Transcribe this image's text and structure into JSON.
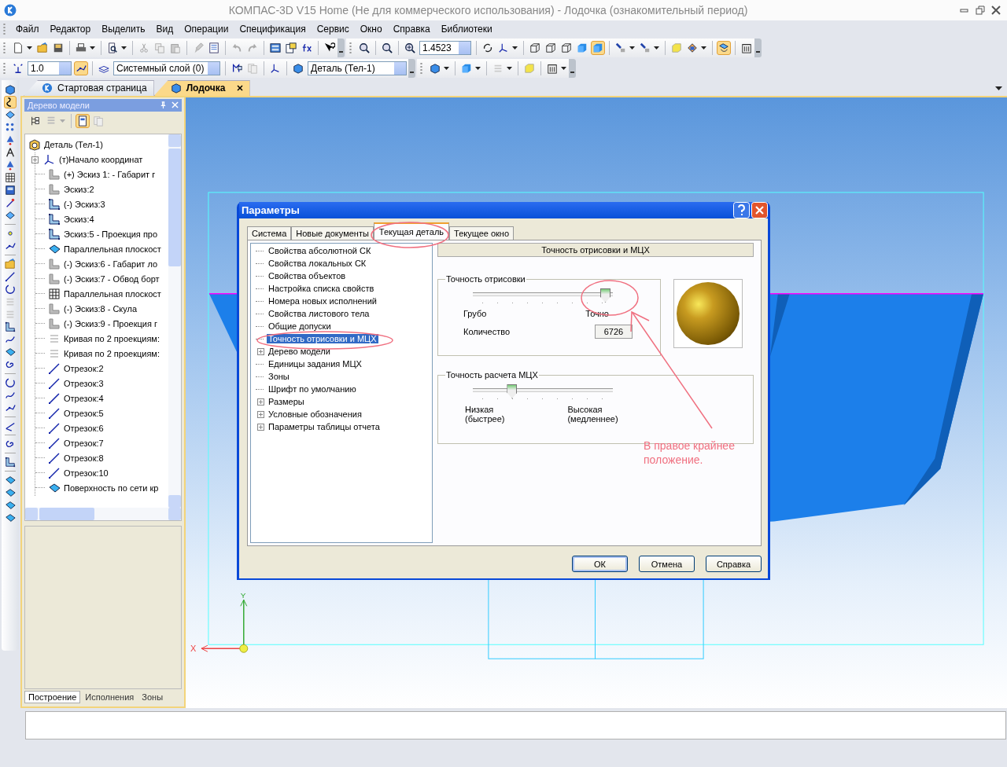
{
  "window": {
    "title": "КОМПАС-3D V15 Home (Не для коммерческого использования) - Лодочка (ознакомительный период)"
  },
  "menu": [
    "Файл",
    "Редактор",
    "Выделить",
    "Вид",
    "Операции",
    "Спецификация",
    "Сервис",
    "Окно",
    "Справка",
    "Библиотеки"
  ],
  "toolbar": {
    "scale": "1.4523",
    "line_step": "1.0",
    "layer": "Системный слой (0)",
    "body": "Деталь (Тел-1)"
  },
  "doc_tabs": [
    {
      "label": "Стартовая страница",
      "selected": false
    },
    {
      "label": "Лодочка",
      "selected": true
    }
  ],
  "model_tree": {
    "title": "Дерево модели",
    "root": "Деталь (Тел-1)",
    "items": [
      {
        "label": "(т)Начало координат",
        "kind": "origin",
        "collapsed": true
      },
      {
        "label": "(+) Эскиз 1: - Габарит г",
        "kind": "sketch",
        "collapsed": false
      },
      {
        "label": "Эскиз:2",
        "kind": "sketch",
        "collapsed": false
      },
      {
        "label": "(-) Эскиз:3",
        "kind": "sketch-active",
        "collapsed": false
      },
      {
        "label": "Эскиз:4",
        "kind": "sketch-active",
        "collapsed": false
      },
      {
        "label": "Эскиз:5 - Проекция про",
        "kind": "sketch-active",
        "collapsed": false
      },
      {
        "label": "Параллельная плоскост",
        "kind": "plane",
        "collapsed": false
      },
      {
        "label": "(-) Эскиз:6 - Габарит ло",
        "kind": "sketch",
        "collapsed": false
      },
      {
        "label": "(-) Эскиз:7 - Обвод борт",
        "kind": "sketch",
        "collapsed": false
      },
      {
        "label": "Параллельная плоскост",
        "kind": "plane-hidden",
        "collapsed": false
      },
      {
        "label": "(-) Эскиз:8 - Скула",
        "kind": "sketch",
        "collapsed": false
      },
      {
        "label": "(-) Эскиз:9 - Проекция г",
        "kind": "sketch",
        "collapsed": false
      },
      {
        "label": "Кривая по 2 проекциям:",
        "kind": "curve",
        "collapsed": false
      },
      {
        "label": "Кривая по 2 проекциям:",
        "kind": "curve",
        "collapsed": false
      },
      {
        "label": "Отрезок:2",
        "kind": "segment",
        "collapsed": false
      },
      {
        "label": "Отрезок:3",
        "kind": "segment",
        "collapsed": false
      },
      {
        "label": "Отрезок:4",
        "kind": "segment",
        "collapsed": false
      },
      {
        "label": "Отрезок:5",
        "kind": "segment",
        "collapsed": false
      },
      {
        "label": "Отрезок:6",
        "kind": "segment",
        "collapsed": false
      },
      {
        "label": "Отрезок:7",
        "kind": "segment",
        "collapsed": false
      },
      {
        "label": "Отрезок:8",
        "kind": "segment",
        "collapsed": false
      },
      {
        "label": "Отрезок:10",
        "kind": "segment",
        "collapsed": false
      },
      {
        "label": "Поверхность по сети кр",
        "kind": "surface",
        "collapsed": false
      }
    ],
    "bottom_tabs": [
      {
        "label": "Построение",
        "selected": true
      },
      {
        "label": "Исполнения",
        "selected": false
      },
      {
        "label": "Зоны",
        "selected": false
      }
    ]
  },
  "dialog": {
    "title": "Параметры",
    "tabs": [
      {
        "label": "Система",
        "selected": false
      },
      {
        "label": "Новые документы",
        "selected": false
      },
      {
        "label": "Текущая деталь",
        "selected": true
      },
      {
        "label": "Текущее окно",
        "selected": false
      }
    ],
    "tree": [
      {
        "label": "Свойства абсолютной СК",
        "selected": false,
        "collapsed": false
      },
      {
        "label": "Свойства локальных СК",
        "selected": false,
        "collapsed": false
      },
      {
        "label": "Свойства объектов",
        "selected": false,
        "collapsed": false
      },
      {
        "label": "Настройка списка свойств",
        "selected": false,
        "collapsed": false
      },
      {
        "label": "Номера новых исполнений",
        "selected": false,
        "collapsed": false
      },
      {
        "label": "Свойства листового тела",
        "selected": false,
        "collapsed": false
      },
      {
        "label": "Общие допуски",
        "selected": false,
        "collapsed": false
      },
      {
        "label": "Точность отрисовки и МЦХ",
        "selected": true,
        "collapsed": false
      },
      {
        "label": "Дерево модели",
        "selected": false,
        "collapsed": true
      },
      {
        "label": "Единицы задания МЦХ",
        "selected": false,
        "collapsed": false
      },
      {
        "label": "Зоны",
        "selected": false,
        "collapsed": false
      },
      {
        "label": "Шрифт по умолчанию",
        "selected": false,
        "collapsed": false
      },
      {
        "label": "Размеры",
        "selected": false,
        "collapsed": true
      },
      {
        "label": "Условные обозначения",
        "selected": false,
        "collapsed": true
      },
      {
        "label": "Параметры таблицы отчета",
        "selected": false,
        "collapsed": true
      }
    ],
    "section_title": "Точность отрисовки и МЦХ",
    "render_group": {
      "title": "Точность отрисовки",
      "level": 0.97,
      "min_label": "Грубо",
      "max_label": "Точно",
      "count_label": "Количество",
      "count": "6726"
    },
    "mcx_group": {
      "title": "Точность расчета МЦХ",
      "level": 0.26,
      "min_label": "Низкая\n(быстрее)",
      "max_label": "Высокая\n(медленнее)"
    },
    "buttons": [
      {
        "label": "ОК",
        "default": true
      },
      {
        "label": "Отмена",
        "default": false
      },
      {
        "label": "Справка",
        "default": false
      }
    ]
  },
  "viewport": {
    "axis_x": "X",
    "axis_y": "Y"
  },
  "annotation": {
    "text": "В правое крайнее положение."
  }
}
